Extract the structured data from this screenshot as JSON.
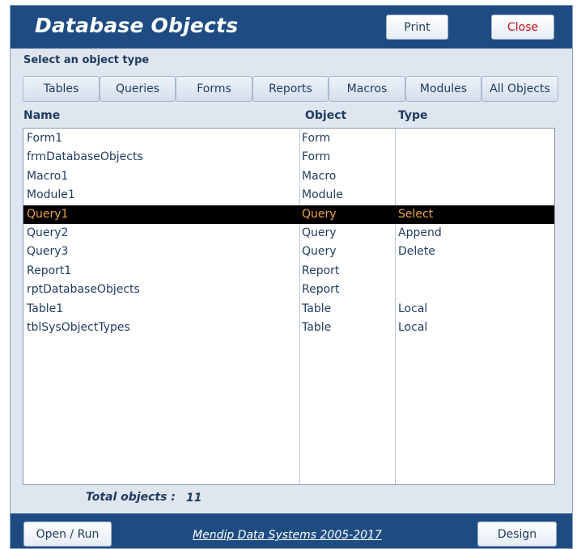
{
  "window": {
    "title": "Database Objects"
  },
  "buttons": {
    "print": "Print",
    "close": "Close",
    "open_run": "Open / Run",
    "design": "Design"
  },
  "select_label": "Select an object type",
  "tabs": [
    "Tables",
    "Queries",
    "Forms",
    "Reports",
    "Macros",
    "Modules",
    "All Objects"
  ],
  "columns": {
    "name": "Name",
    "object": "Object",
    "type": "Type"
  },
  "rows": [
    {
      "name": "Form1",
      "object": "Form",
      "type": ""
    },
    {
      "name": "frmDatabaseObjects",
      "object": "Form",
      "type": ""
    },
    {
      "name": "Macro1",
      "object": "Macro",
      "type": ""
    },
    {
      "name": "Module1",
      "object": "Module",
      "type": ""
    },
    {
      "name": "Query1",
      "object": "Query",
      "type": "Select",
      "selected": true
    },
    {
      "name": "Query2",
      "object": "Query",
      "type": "Append"
    },
    {
      "name": "Query3",
      "object": "Query",
      "type": "Delete"
    },
    {
      "name": "Report1",
      "object": "Report",
      "type": ""
    },
    {
      "name": "rptDatabaseObjects",
      "object": "Report",
      "type": ""
    },
    {
      "name": "Table1",
      "object": "Table",
      "type": "Local"
    },
    {
      "name": "tblSysObjectTypes",
      "object": "Table",
      "type": "Local"
    }
  ],
  "total": {
    "label": "Total objects :",
    "value": "11"
  },
  "footer": {
    "credit": "Mendip Data Systems 2005-2017"
  },
  "colors": {
    "header_bg": "#1e4c82",
    "selected_row_bg": "#000000",
    "selected_row_text": "#f0a44a",
    "close_text": "#c0141b"
  }
}
